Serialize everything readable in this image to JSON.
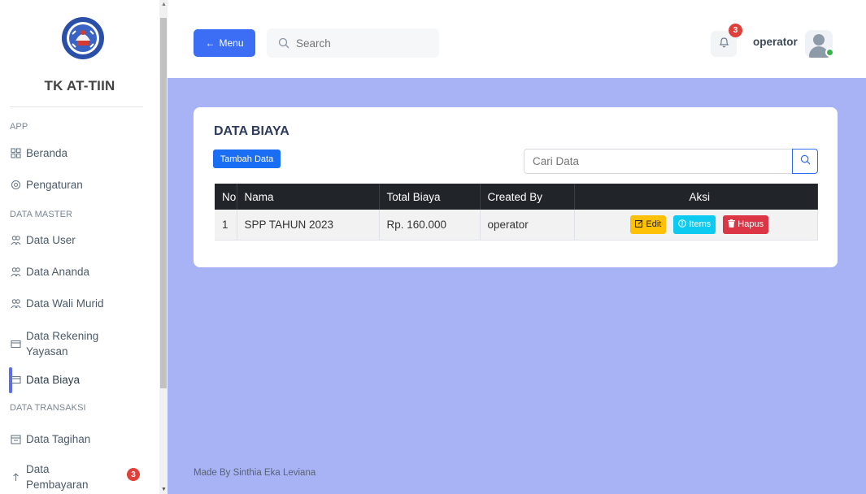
{
  "brand": {
    "title": "TK AT-TIIN",
    "logo_icon": "school-emblem-icon"
  },
  "sidebar": {
    "sections": [
      {
        "label": "APP"
      },
      {
        "label": "DATA MASTER"
      },
      {
        "label": "DATA TRANSAKSI"
      }
    ],
    "items": [
      {
        "label": "Beranda",
        "icon": "grid-icon"
      },
      {
        "label": "Pengaturan",
        "icon": "gear-icon"
      },
      {
        "label": "Data User",
        "icon": "users-icon"
      },
      {
        "label": "Data Ananda",
        "icon": "users-icon"
      },
      {
        "label": "Data Wali Murid",
        "icon": "users-icon"
      },
      {
        "label": "Data Rekening Yayasan",
        "line1": "Data Rekening",
        "line2": "Yayasan",
        "icon": "card-icon"
      },
      {
        "label": "Data Biaya",
        "icon": "card-icon",
        "active": true
      },
      {
        "label": "Data Tagihan",
        "icon": "calendar-icon"
      },
      {
        "label": "Data Pembayaran",
        "line1": "Data",
        "line2": "Pembayaran",
        "icon": "upload-icon",
        "badge": "3"
      }
    ]
  },
  "topbar": {
    "menu_label": "Menu",
    "search_placeholder": "Search",
    "notification_count": "3",
    "username": "operator"
  },
  "card": {
    "title": "DATA BIAYA",
    "add_button": "Tambah Data",
    "search_placeholder": "Cari Data",
    "columns": [
      "No",
      "Nama",
      "Total Biaya",
      "Created By",
      "Aksi"
    ],
    "rows": [
      {
        "no": "1",
        "nama": "SPP TAHUN 2023",
        "total": "Rp. 160.000",
        "created_by": "operator"
      }
    ],
    "actions": {
      "edit": "Edit",
      "items": "Items",
      "hapus": "Hapus"
    }
  },
  "footer": {
    "text": "Made By Sinthia Eka Leviana"
  },
  "colors": {
    "accent": "#3b6ef5",
    "main_bg": "#a8b3f6",
    "danger": "#dc3545",
    "warning": "#ffc107",
    "info": "#0dcaf0"
  }
}
